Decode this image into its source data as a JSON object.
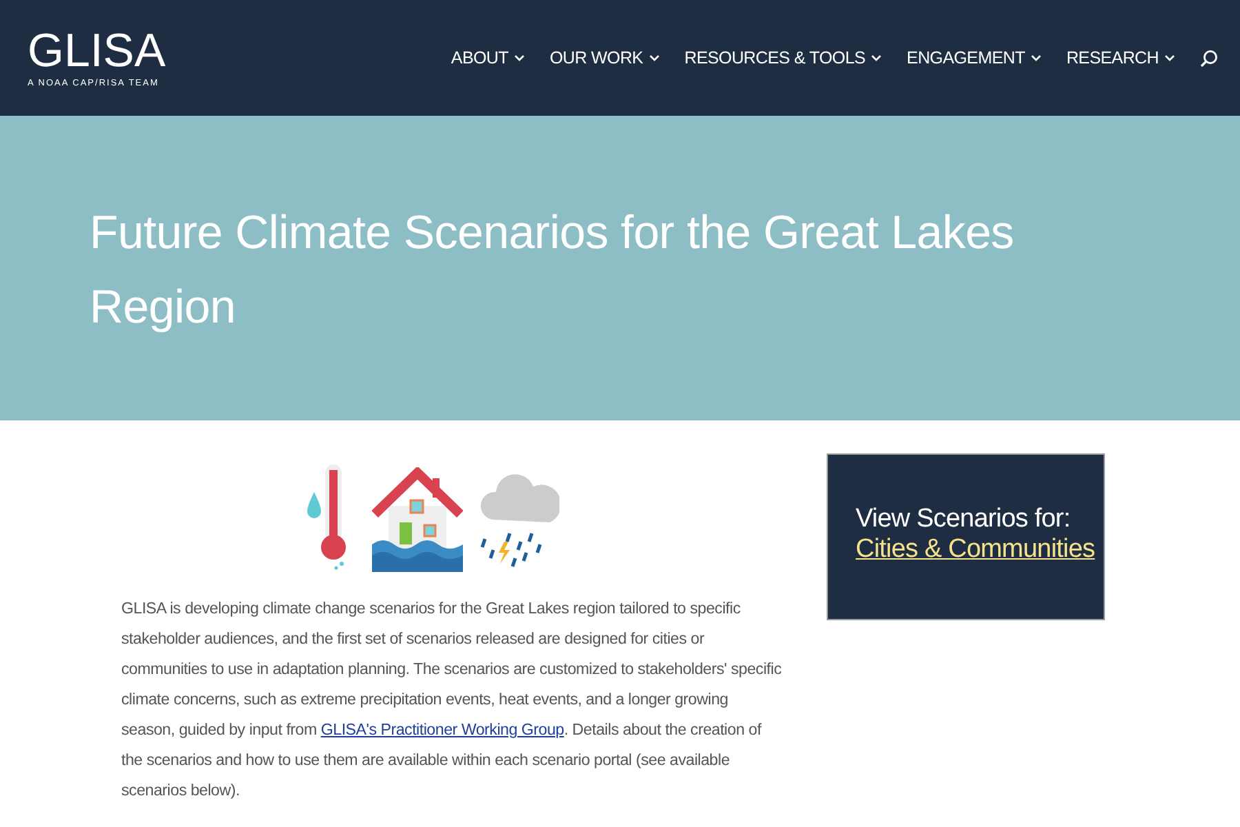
{
  "header": {
    "logo": "GLISA",
    "tagline": "A NOAA CAP/RISA TEAM",
    "nav": [
      {
        "label": "ABOUT"
      },
      {
        "label": "OUR WORK"
      },
      {
        "label": "RESOURCES & TOOLS"
      },
      {
        "label": "ENGAGEMENT"
      },
      {
        "label": "RESEARCH"
      }
    ]
  },
  "banner": {
    "title": "Future Climate Scenarios for the Great Lakes Region"
  },
  "intro": {
    "before": "GLISA is developing climate change scenarios for the Great Lakes region tailored to specific stakeholder audiences, and the first set of scenarios released are designed for cities or communities to use in adaptation planning. The scenarios are customized to stakeholders' specific climate concerns, such as extreme precipitation events, heat events, and a longer growing season, guided by input from ",
    "link": "GLISA's Practitioner Working Group",
    "after": ". Details about the creation of the scenarios and how to use them are available within each scenario portal (see available scenarios below)."
  },
  "card": {
    "heading": "View Scenarios for:",
    "link": "Cities & Communities"
  }
}
